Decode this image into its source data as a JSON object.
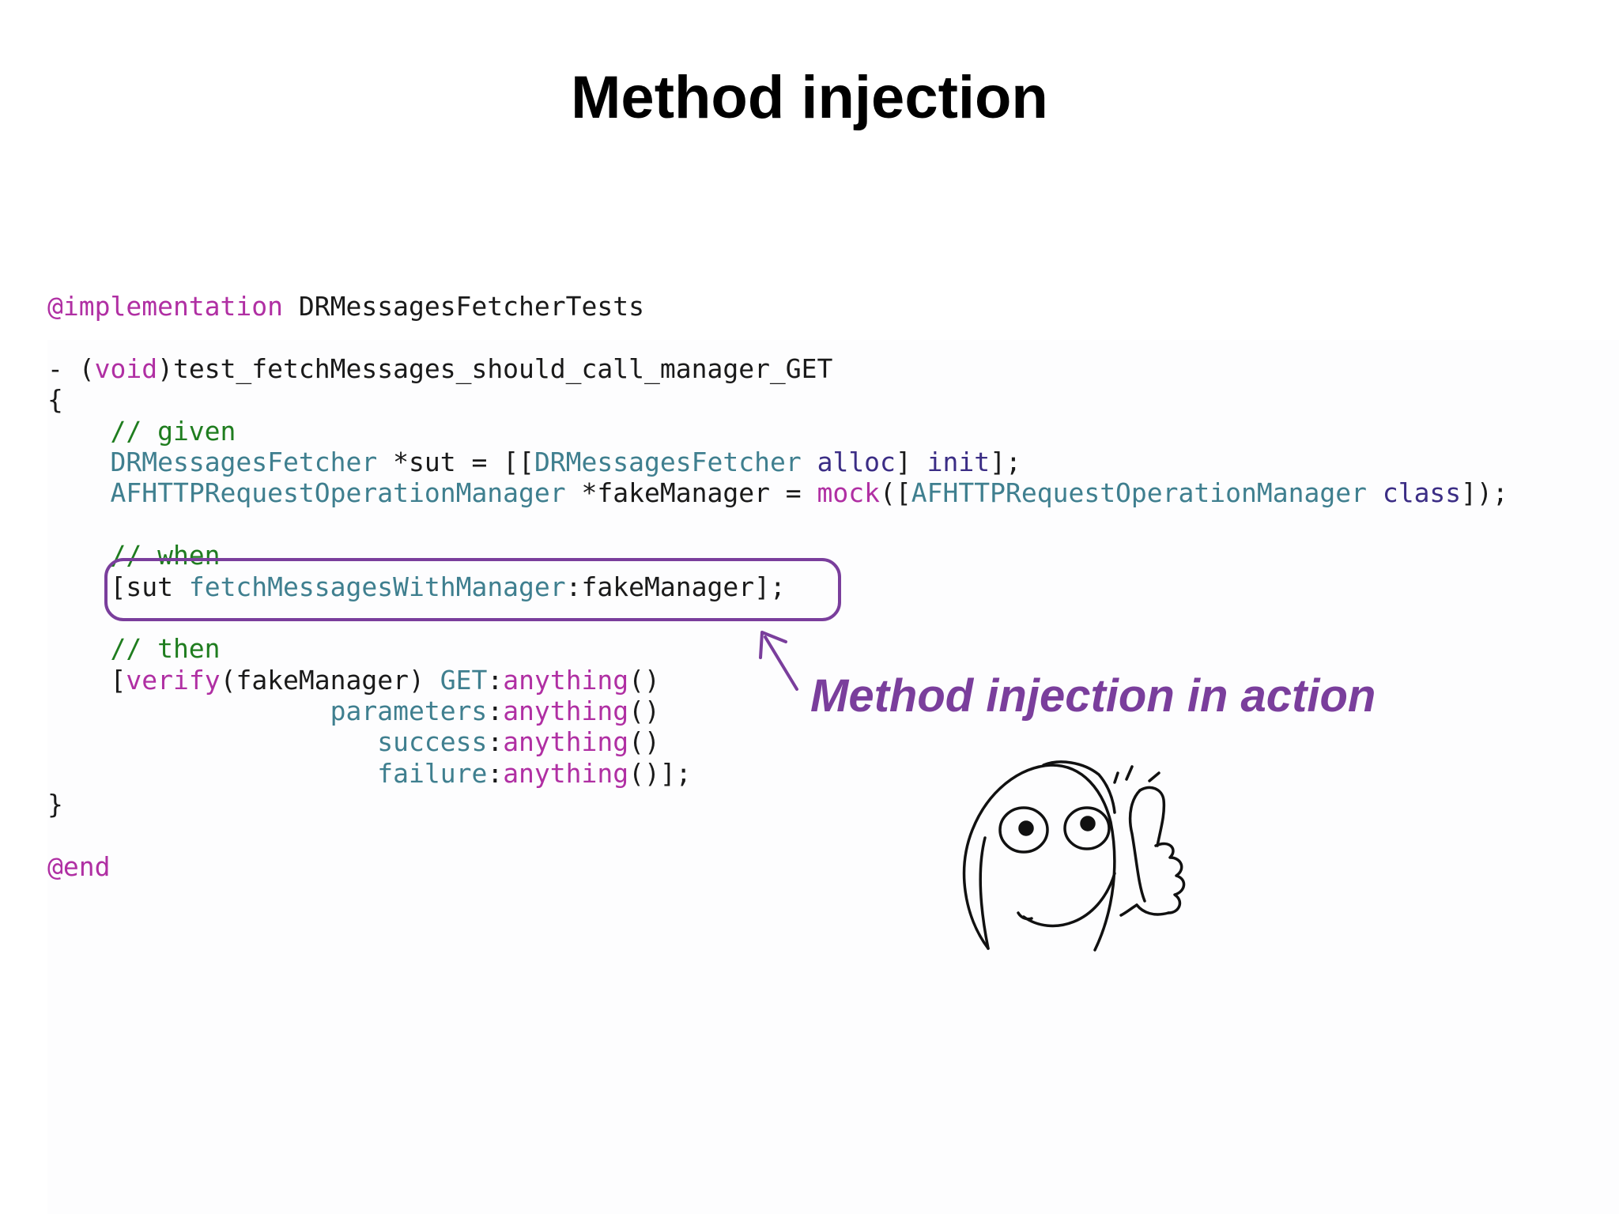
{
  "slide": {
    "title": "Method injection"
  },
  "code": {
    "line1_kw": "@implementation",
    "line1_text": " DRMessagesFetcherTests",
    "line3_prefix": "- (",
    "line3_kw": "void",
    "line3_text": ")test_fetchMessages_should_call_manager_GET",
    "line4": "{",
    "line5_comment": "    // given",
    "line6_indent": "    ",
    "line6_cls": "DRMessagesFetcher",
    "line6_mid": " *sut = [[",
    "line6_cls2": "DRMessagesFetcher",
    "line6_sp": " ",
    "line6_alloc": "alloc",
    "line6_mid2": "] ",
    "line6_init": "init",
    "line6_end": "];",
    "line7_indent": "    ",
    "line7_cls": "AFHTTPRequestOperationManager",
    "line7_mid": " *fakeManager = ",
    "line7_mock": "mock",
    "line7_mid2": "([",
    "line7_cls2": "AFHTTPRequestOperationManager",
    "line7_sp": " ",
    "line7_class": "class",
    "line7_end": "]);",
    "line9_comment": "    // when",
    "line10_indent": "    ",
    "line10_a": "[sut ",
    "line10_method": "fetchMessagesWithManager",
    "line10_b": ":fakeManager];",
    "line12_comment": "    // then",
    "line13_indent": "    ",
    "line13_a": "[",
    "line13_verify": "verify",
    "line13_b": "(fakeManager) ",
    "line13_get": "GET",
    "line13_c": ":",
    "line13_any": "anything",
    "line13_d": "()",
    "line14_indent": "                  ",
    "line14_param": "parameters",
    "line14_c": ":",
    "line14_any": "anything",
    "line14_d": "()",
    "line15_indent": "                     ",
    "line15_param": "success",
    "line15_c": ":",
    "line15_any": "anything",
    "line15_d": "()",
    "line16_indent": "                     ",
    "line16_param": "failure",
    "line16_c": ":",
    "line16_any": "anything",
    "line16_d": "()];",
    "line17": "}",
    "line19_kw": "@end"
  },
  "annotation": {
    "label": "Method injection in action",
    "color": "#7a3e9c"
  },
  "colors": {
    "keyword": "#b02fa3",
    "comment": "#1f7d1f",
    "class_name": "#3f7f8f",
    "call": "#3b2d85",
    "plain": "#1a1a1a"
  },
  "icons": {
    "doodle": "thumbs-up-face-doodle-icon",
    "arrow": "arrow-up-left-icon"
  }
}
